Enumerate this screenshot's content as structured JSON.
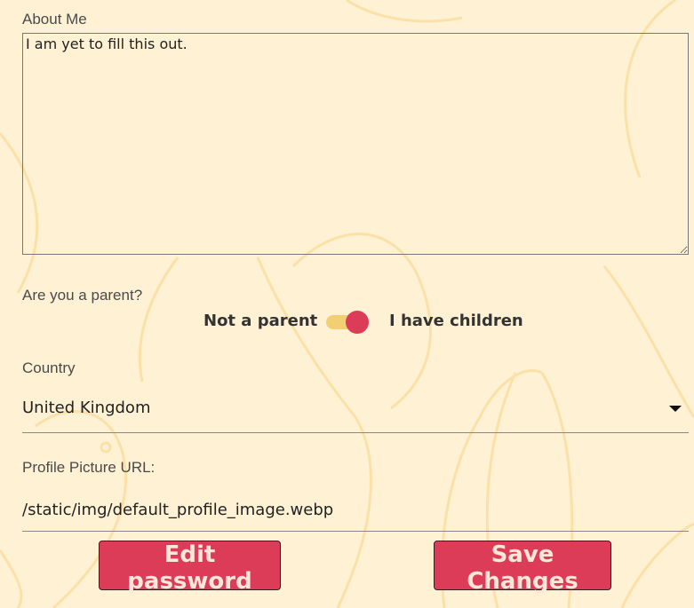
{
  "form": {
    "about_label": "About Me",
    "about_value": "I am yet to fill this out.",
    "parent_label": "Are you a parent?",
    "toggle_off_label": "Not a parent",
    "toggle_on_label": "I have children",
    "toggle_checked": true,
    "country_label": "Country",
    "country_value": "United Kingdom",
    "picture_label": "Profile Picture URL:",
    "picture_value": "/static/img/default_profile_image.webp",
    "edit_password_label": "Edit password",
    "save_label": "Save Changes"
  },
  "colors": {
    "background": "#fff1d4",
    "accent": "#dc3c57",
    "toggle_track": "#f2cf70",
    "pattern_stroke": "#fbe0a8"
  }
}
